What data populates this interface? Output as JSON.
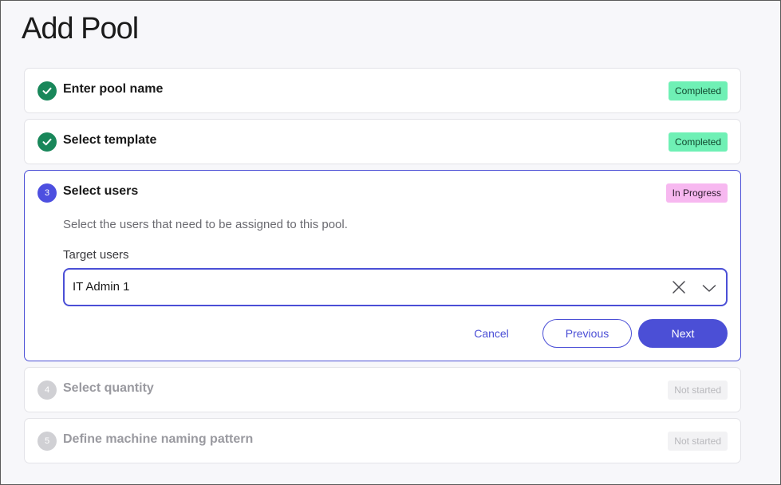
{
  "page": {
    "title": "Add Pool"
  },
  "steps": [
    {
      "title": "Enter pool name",
      "status": "Completed",
      "indicator": "check-icon"
    },
    {
      "title": "Select template",
      "status": "Completed",
      "indicator": "check-icon"
    },
    {
      "number": "3",
      "title": "Select users",
      "status": "In Progress",
      "description": "Select the users that need to be assigned to this pool.",
      "field_label": "Target users",
      "field_value": "IT Admin 1",
      "cancel_label": "Cancel",
      "previous_label": "Previous",
      "next_label": "Next"
    },
    {
      "number": "4",
      "title": "Select quantity",
      "status": "Not started"
    },
    {
      "number": "5",
      "title": "Define machine naming pattern",
      "status": "Not started"
    }
  ],
  "colors": {
    "accent": "#4b4fd6",
    "completed_badge": "#6ff0b5",
    "in_progress_badge": "#f7b8f0",
    "done_circle": "#19875a"
  }
}
